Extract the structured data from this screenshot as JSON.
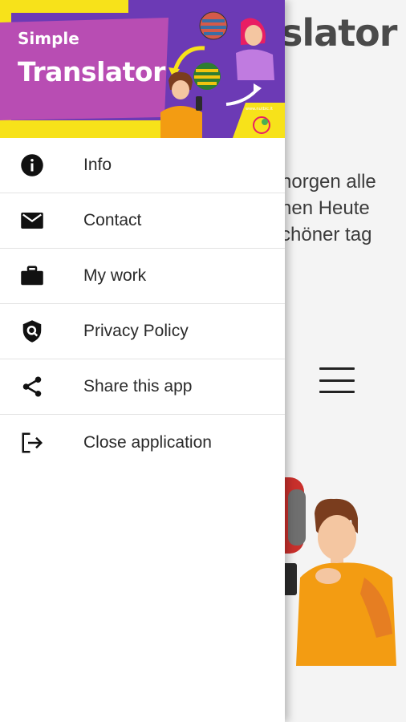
{
  "app": {
    "title_partial": "slator",
    "body_lines": [
      "horgen alle",
      "hen Heute",
      "chöner tag"
    ]
  },
  "drawer": {
    "header": {
      "brand_small": "Simple",
      "brand_big": "Translator",
      "url": "www.nutbic.it",
      "colors": {
        "purple": "#6c3ab5",
        "magenta": "#b84db3",
        "yellow": "#f7e21a"
      }
    },
    "menu": [
      {
        "label": "Info",
        "icon": "info-icon"
      },
      {
        "label": "Contact",
        "icon": "mail-icon"
      },
      {
        "label": "My work",
        "icon": "briefcase-icon"
      },
      {
        "label": "Privacy Policy",
        "icon": "shield-search-icon"
      },
      {
        "label": "Share this app",
        "icon": "share-icon"
      },
      {
        "label": "Close application",
        "icon": "exit-icon"
      }
    ]
  }
}
